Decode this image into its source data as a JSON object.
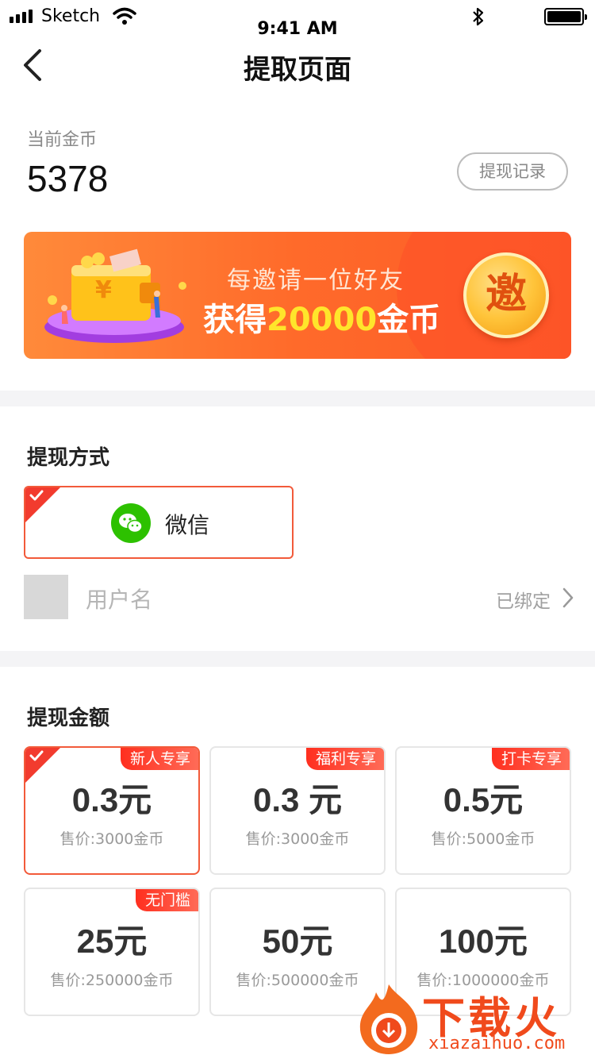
{
  "status_bar": {
    "carrier": "Sketch",
    "time": "9:41 AM"
  },
  "nav": {
    "title": "提取页面"
  },
  "balance": {
    "label": "当前金币",
    "value": "5378",
    "record_button": "提现记录"
  },
  "banner": {
    "line1": "每邀请一位好友",
    "line2_prefix": "获得",
    "line2_highlight": "20000",
    "line2_suffix": "金币",
    "coin_text": "邀",
    "wallet_symbol": "¥"
  },
  "method": {
    "title": "提现方式",
    "option_label": "微信",
    "account_name": "用户名",
    "account_status": "已绑定"
  },
  "amount": {
    "title": "提现金额",
    "options": [
      {
        "tag": "新人专享",
        "value": "0.3元",
        "price": "售价:3000金币",
        "selected": true
      },
      {
        "tag": "福利专享",
        "value": "0.3 元",
        "price": "售价:3000金币",
        "selected": false
      },
      {
        "tag": "打卡专享",
        "value": "0.5元",
        "price": "售价:5000金币",
        "selected": false
      },
      {
        "tag": "无门槛",
        "value": "25元",
        "price": "售价:250000金币",
        "selected": false
      },
      {
        "tag": "",
        "value": "50元",
        "price": "售价:500000金币",
        "selected": false
      },
      {
        "tag": "",
        "value": "100元",
        "price": "售价:1000000金币",
        "selected": false
      }
    ]
  },
  "watermark": {
    "brand": "下载火",
    "url": "xiazaihuo.com"
  },
  "colors": {
    "accent": "#f25a3a",
    "tag_red": "#ff2f1f",
    "wechat_green": "#2dc100",
    "banner_orange": "#ff7a33",
    "highlight_yellow": "#ffe52b"
  }
}
